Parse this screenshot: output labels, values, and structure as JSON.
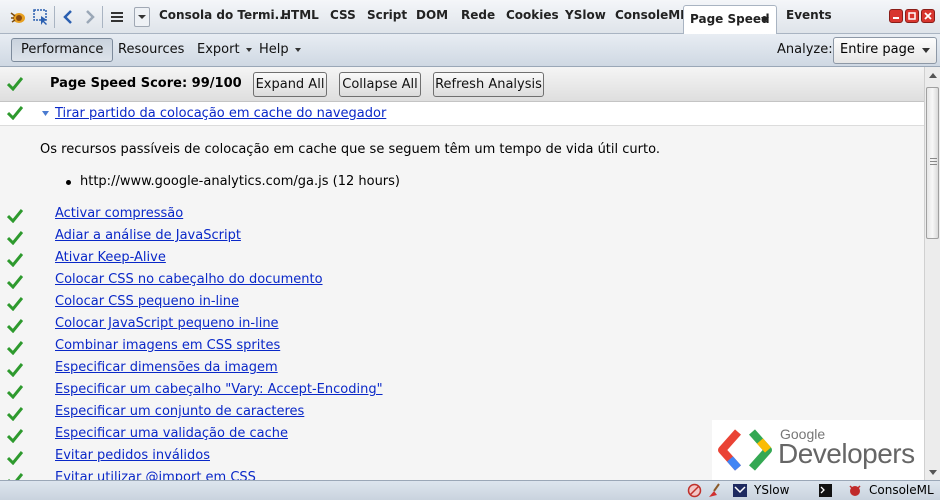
{
  "tabbar": {
    "tabs": [
      "Consola do Termi...",
      "HTML",
      "CSS",
      "Script",
      "DOM",
      "Rede",
      "Cookies",
      "YSlow",
      "ConsoleML",
      "Page Speed",
      "Events"
    ],
    "active_tab": "Page Speed"
  },
  "toolbar": {
    "performance": "Performance",
    "resources": "Resources",
    "export": "Export",
    "help": "Help",
    "analyze_label": "Analyze:",
    "analyze_value": "Entire page"
  },
  "score": {
    "title": "Page Speed Score: 99/100",
    "expand": "Expand All",
    "collapse": "Collapse All",
    "refresh": "Refresh Analysis"
  },
  "expanded_rule": {
    "title": "Tirar partido da colocação em cache do navegador",
    "description": "Os recursos passíveis de colocação em cache que se seguem têm um tempo de vida útil curto.",
    "items": [
      "http://www.google-analytics.com/ga.js (12 hours)"
    ]
  },
  "rules": [
    "Activar compressão",
    "Adiar a análise de JavaScript",
    "Ativar Keep-Alive",
    "Colocar CSS no cabeçalho do documento",
    "Colocar CSS pequeno in-line",
    "Colocar JavaScript pequeno in-line",
    "Combinar imagens em CSS sprites",
    "Especificar dimensões da imagem",
    "Especificar um cabeçalho \"Vary: Accept-Encoding\"",
    "Especificar um conjunto de caracteres",
    "Especificar uma validação de cache",
    "Evitar pedidos inválidos",
    "Evitar utilizar @import em CSS"
  ],
  "watermark": {
    "small": "Google",
    "big": "Developers"
  },
  "statusbar": {
    "yslow": "YSlow",
    "consoleml": "ConsoleML"
  },
  "colors": {
    "link": "#0a28c8",
    "check": "#2e9a2e"
  }
}
